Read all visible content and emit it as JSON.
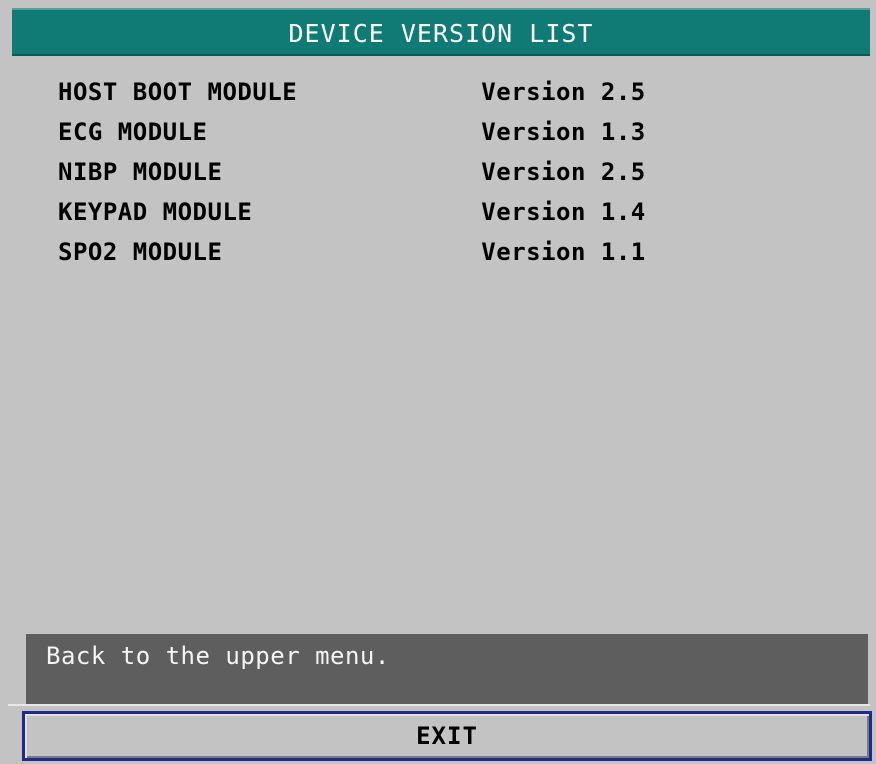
{
  "title": "DEVICE VERSION LIST",
  "modules": [
    {
      "name": "HOST BOOT MODULE",
      "version": "Version 2.5"
    },
    {
      "name": "ECG MODULE",
      "version": "Version 1.3"
    },
    {
      "name": "NIBP MODULE",
      "version": "Version 2.5"
    },
    {
      "name": "KEYPAD MODULE",
      "version": "Version 1.4"
    },
    {
      "name": "SPO2 MODULE",
      "version": "Version 1.1"
    }
  ],
  "help_text": "Back to the upper menu.",
  "exit_label": "EXIT",
  "colors": {
    "title_bar": "#0f7b74",
    "background": "#c3c3c3",
    "help_box": "#5e5e5e",
    "focus_border": "#1e2b8c"
  }
}
